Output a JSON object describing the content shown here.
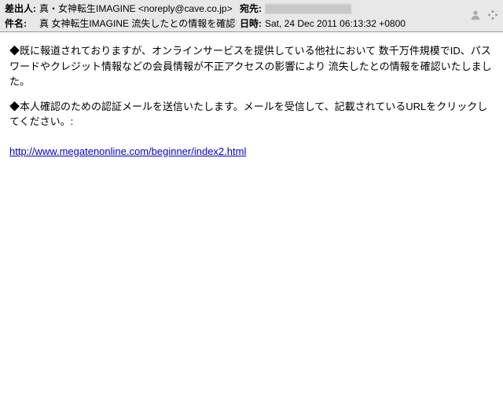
{
  "header": {
    "from_label": "差出人:",
    "from_value": "真・女神転生IMAGINE <noreply@cave.co.jp>",
    "to_label": "宛先:",
    "subject_label": "件名:",
    "subject_value": "真 女神転生IMAGINE 流失したとの情報を確認いたしました",
    "date_label": "日時:",
    "date_value": "Sat, 24 Dec 2011 06:13:32 +0800"
  },
  "body": {
    "p1": "◆既に報道されておりますが、オンラインサービスを提供している他社において 数千万件規模でID、パスワードやクレジット情報などの会員情報が不正アクセスの影響により 流失したとの情報を確認いたしました。",
    "p2": "◆本人確認のための認証メールを送信いたします。メールを受信して、記載されているURLをクリックしてください。:",
    "link_text": "http://www.megatenonline.com/beginner/index2.html"
  }
}
